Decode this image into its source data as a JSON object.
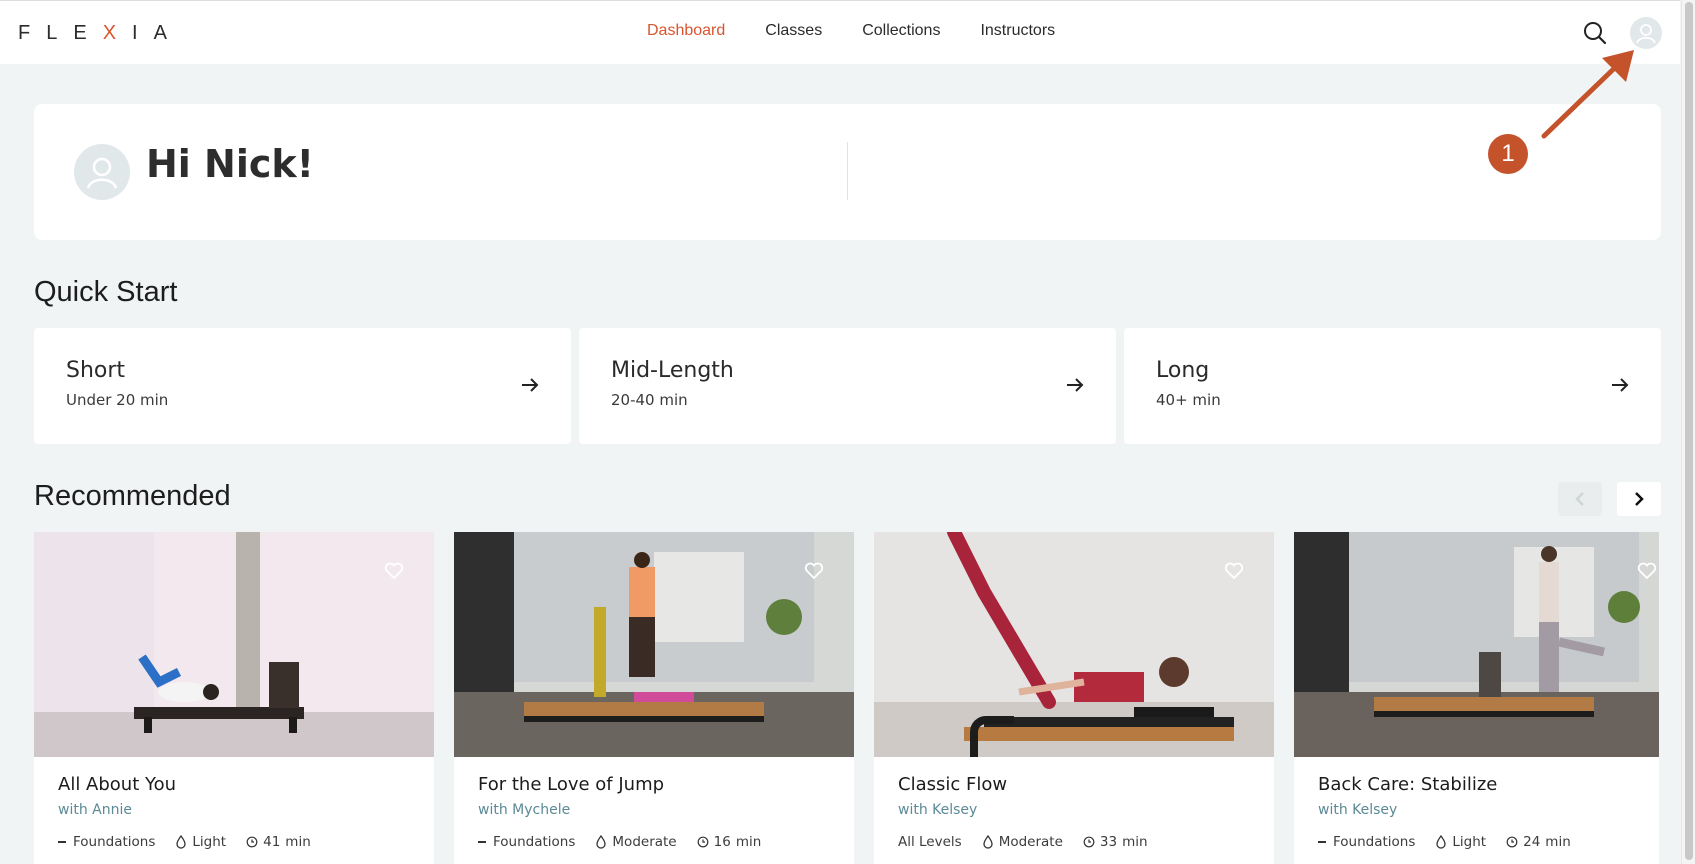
{
  "brand": {
    "logo_pre": "FLE",
    "logo_x": "X",
    "logo_post": "IA"
  },
  "nav": {
    "items": [
      "Dashboard",
      "Classes",
      "Collections",
      "Instructors"
    ],
    "active": "Dashboard"
  },
  "colors": {
    "accent": "#d9552f",
    "badge": "#c4522b",
    "instructor_text": "#5b8a96"
  },
  "greeting": {
    "title": "Hi Nick!"
  },
  "annotation": {
    "number": "1"
  },
  "quick_start": {
    "title": "Quick Start",
    "cards": [
      {
        "title": "Short",
        "subtitle": "Under 20 min"
      },
      {
        "title": "Mid-Length",
        "subtitle": "20-40 min"
      },
      {
        "title": "Long",
        "subtitle": "40+ min"
      }
    ]
  },
  "recommended": {
    "title": "Recommended",
    "classes": [
      {
        "title": "All About You",
        "instructor": "with Annie",
        "level": "Foundations",
        "intensity": "Light",
        "duration_num": "41",
        "duration_unit": "min"
      },
      {
        "title": "For the Love of Jump",
        "instructor": "with Mychele",
        "level": "Foundations",
        "intensity": "Moderate",
        "duration_num": "16",
        "duration_unit": "min"
      },
      {
        "title": "Classic Flow",
        "instructor": "with Kelsey",
        "level": "All Levels",
        "intensity": "Moderate",
        "duration_num": "33",
        "duration_unit": "min"
      },
      {
        "title": "Back Care: Stabilize",
        "instructor": "with Kelsey",
        "level": "Foundations",
        "intensity": "Light",
        "duration_num": "24",
        "duration_unit": "min"
      }
    ]
  }
}
